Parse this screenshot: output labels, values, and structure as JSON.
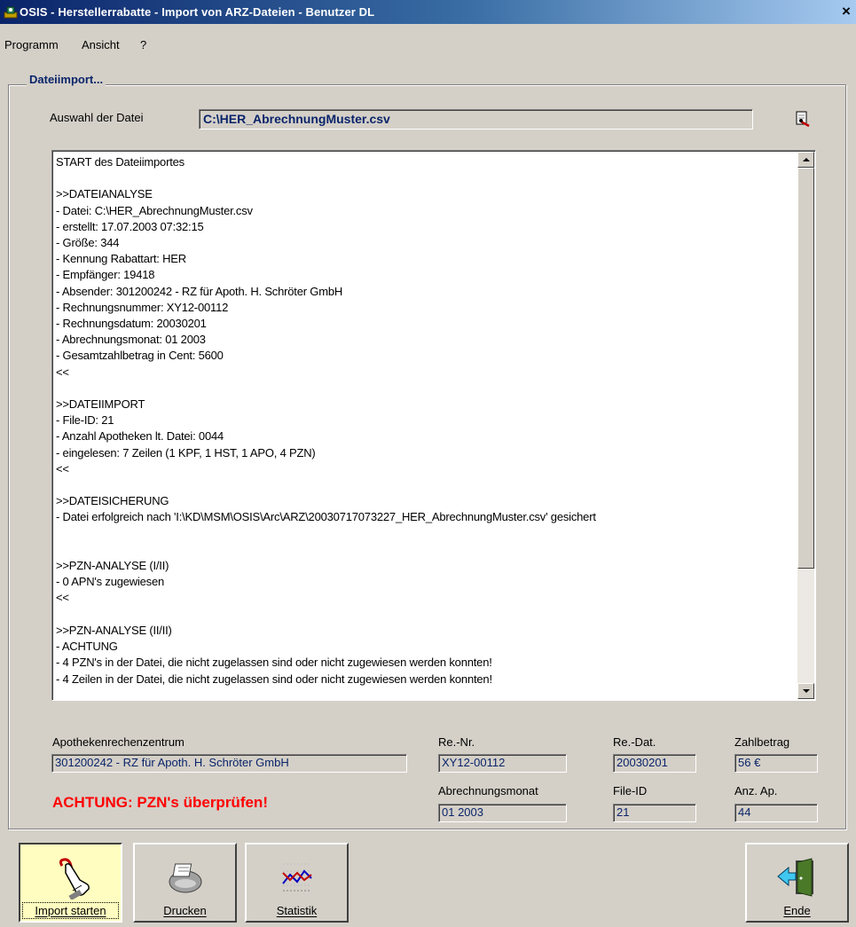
{
  "window": {
    "title": "OSIS - Herstellerrabatte - Import von ARZ-Dateien - Benutzer DL",
    "close_symbol": "×"
  },
  "menu": [
    "Programm",
    "Ansicht",
    "?"
  ],
  "group": {
    "title": "Dateiimport..."
  },
  "file": {
    "label": "Auswahl der Datei",
    "value": "C:\\HER_AbrechnungMuster.csv",
    "browse_icon": "open-file-icon"
  },
  "log": {
    "lines": [
      "START des Dateiimportes",
      "",
      ">>DATEIANALYSE",
      "- Datei: C:\\HER_AbrechnungMuster.csv",
      "- erstellt: 17.07.2003 07:32:15",
      "- Größe: 344",
      "- Kennung Rabattart: HER",
      "- Empfänger: 19418",
      "- Absender: 301200242 - RZ für Apoth. H. Schröter GmbH",
      "- Rechnungsnummer: XY12-00112",
      "- Rechnungsdatum: 20030201",
      "- Abrechnungsmonat: 01 2003",
      "- Gesamtzahlbetrag in Cent: 5600",
      "<<",
      "",
      ">>DATEIIMPORT",
      "- File-ID: 21",
      "- Anzahl Apotheken lt. Datei: 0044",
      "- eingelesen: 7 Zeilen (1 KPF, 1 HST, 1 APO, 4 PZN)",
      "<<",
      "",
      ">>DATEISICHERUNG",
      "- Datei erfolgreich nach 'I:\\KD\\MSM\\OSIS\\Arc\\ARZ\\20030717073227_HER_AbrechnungMuster.csv' gesichert",
      "",
      "",
      ">>PZN-ANALYSE (I/II)",
      "- 0 APN's zugewiesen",
      "<<",
      "",
      ">>PZN-ANALYSE (II/II)",
      "- ACHTUNG",
      "- 4 PZN's in der Datei, die nicht zugelassen sind oder nicht zugewiesen werden konnten!",
      "- 4 Zeilen in der Datei, die nicht zugelassen sind oder nicht zugewiesen werden konnten!"
    ]
  },
  "info": {
    "arz_label": "Apothekenrechenzentrum",
    "arz_value": "301200242 - RZ für Apoth. H. Schröter GmbH",
    "renr_label": "Re.-Nr.",
    "renr_value": "XY12-00112",
    "redat_label": "Re.-Dat.",
    "redat_value": "20030201",
    "zahlbetrag_label": "Zahlbetrag",
    "zahlbetrag_value": "56 €",
    "monat_label": "Abrechnungsmonat",
    "monat_value": "01 2003",
    "fileid_label": "File-ID",
    "fileid_value": "21",
    "anzap_label": "Anz. Ap.",
    "anzap_value": "44",
    "warning": "ACHTUNG: PZN's überprüfen!"
  },
  "toolbar": {
    "import_label": "Import starten",
    "print_label": "Drucken",
    "stats_label": "Statistik",
    "exit_label": "Ende"
  }
}
